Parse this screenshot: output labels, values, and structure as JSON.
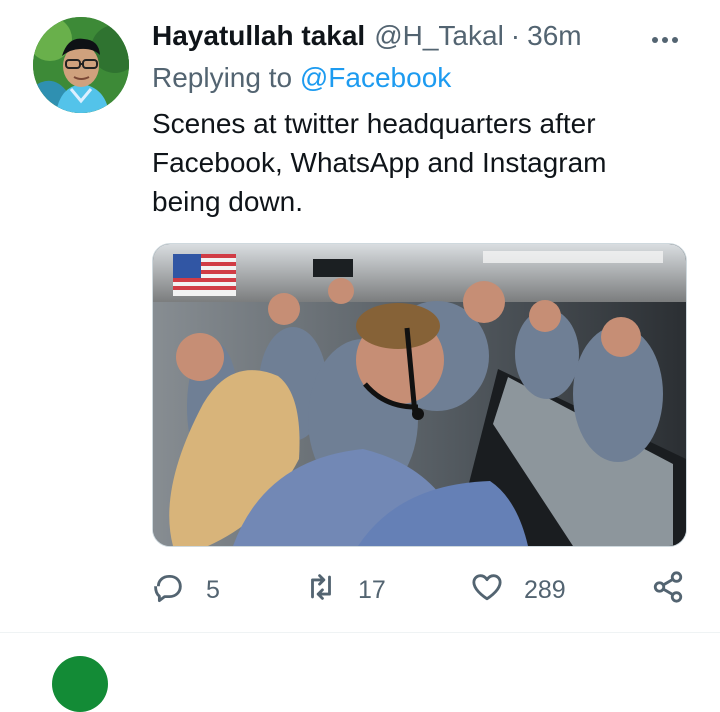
{
  "tweet": {
    "author_name": "Hayatullah takal",
    "author_handle": "@H_Takal",
    "separator": "·",
    "time": "36m",
    "replying_prefix": "Replying to",
    "replying_to": "@Facebook",
    "text": "Scenes at twitter headquarters after Facebook, WhatsApp and Instagram being down.",
    "more_icon": "more-horizontal-icon"
  },
  "actions": {
    "reply": {
      "icon": "reply-icon",
      "count": "5"
    },
    "retweet": {
      "icon": "retweet-icon",
      "count": "17"
    },
    "like": {
      "icon": "heart-icon",
      "count": "289"
    },
    "share": {
      "icon": "share-icon"
    }
  },
  "colors": {
    "accent": "#1d9bf0",
    "secondary_text": "#536471",
    "primary_text": "#0f1419"
  }
}
